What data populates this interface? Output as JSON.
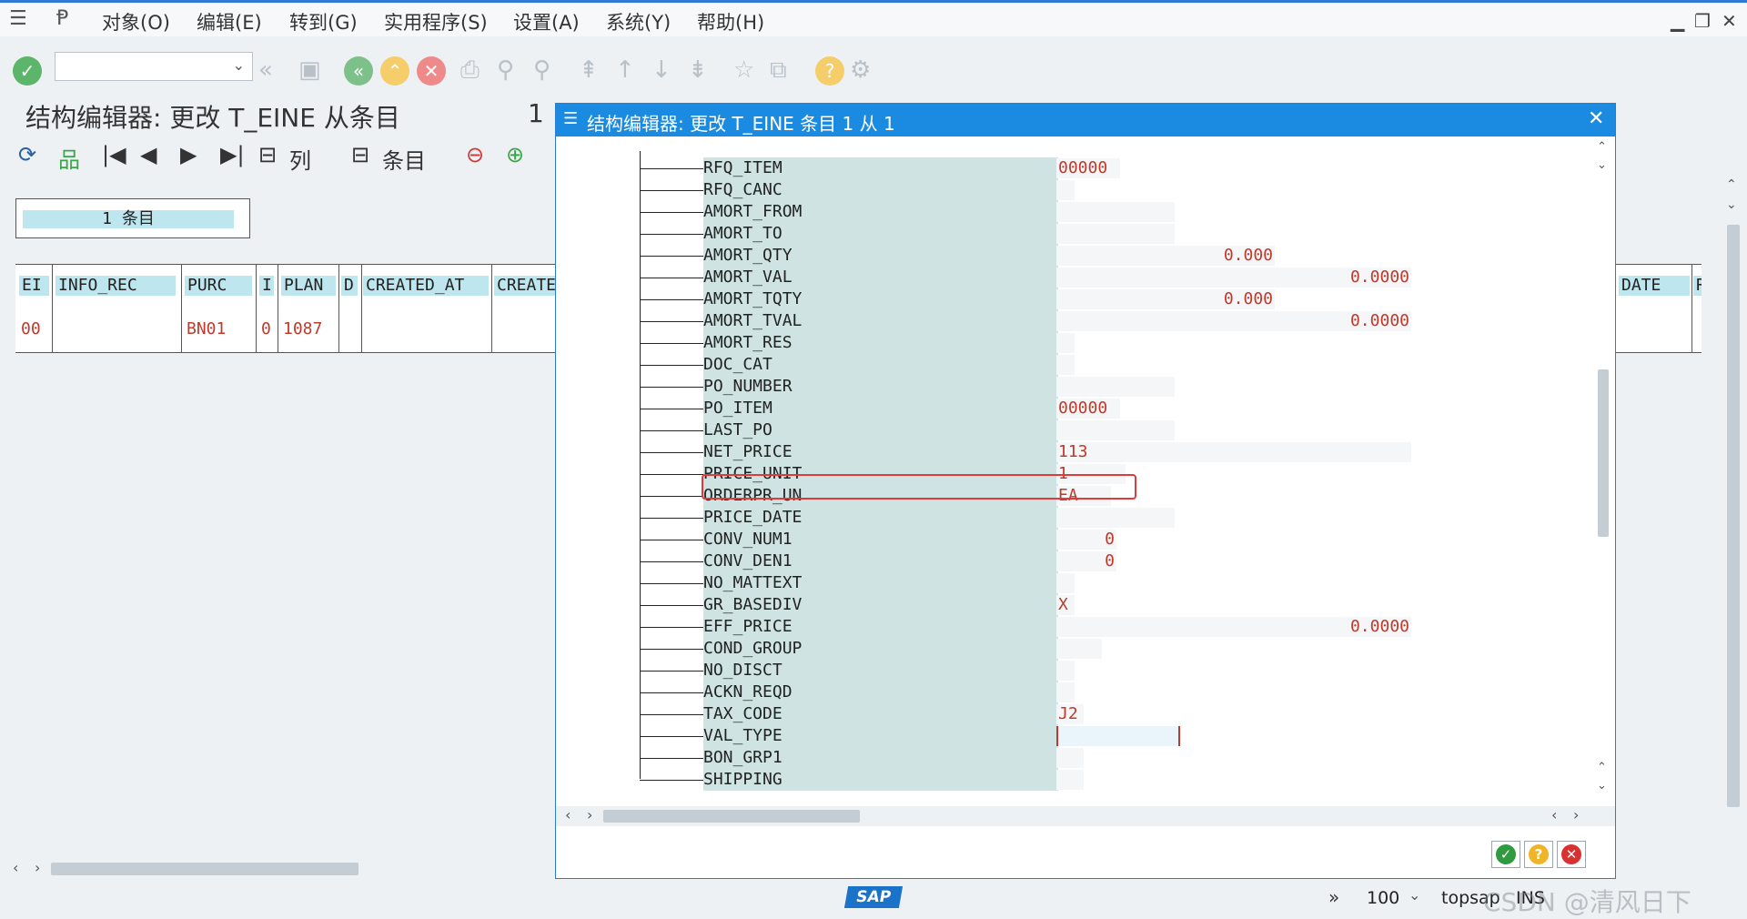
{
  "menu": {
    "items": [
      "对象(O)",
      "编辑(E)",
      "转到(G)",
      "实用程序(S)",
      "设置(A)",
      "系统(Y)",
      "帮助(H)"
    ]
  },
  "toolbar": {
    "icons": [
      "enter-icon",
      "back-icon",
      "save-icon",
      "exit-icon",
      "up-icon",
      "cancel-icon",
      "print-icon",
      "find-icon",
      "find-next-icon",
      "first-page-icon",
      "prev-page-icon",
      "next-page-icon",
      "last-page-icon",
      "new-session-icon",
      "shortcut-icon",
      "help-icon",
      "settings-icon"
    ],
    "colors": {
      "green": "#3aa64a",
      "yellow": "#f0b429",
      "red": "#e04747"
    }
  },
  "page": {
    "title": "结构编辑器: 更改 T_EINE 从条目",
    "entry_num": "1"
  },
  "app_toolbar": {
    "col_label": "列",
    "entry_label": "条目"
  },
  "entries_box": {
    "label": "1 条目"
  },
  "grid": {
    "headers": [
      "EI",
      "INFO_REC",
      "PURC",
      "I",
      "PLAN",
      "D",
      "CREATED_AT",
      "CREATE"
    ],
    "row": [
      "00",
      "",
      "BN01",
      "0",
      "1087",
      "",
      "",
      ""
    ],
    "right_headers": [
      "DATE",
      "R"
    ]
  },
  "dialog": {
    "title": "结构编辑器: 更改 T_EINE 条目 1 从 1",
    "rows": [
      {
        "name": "RFQ_ITEM",
        "value": "00000"
      },
      {
        "name": "RFQ_CANC",
        "value": ""
      },
      {
        "name": "AMORT_FROM",
        "value": ""
      },
      {
        "name": "AMORT_TO",
        "value": ""
      },
      {
        "name": "AMORT_QTY",
        "value": "0.000"
      },
      {
        "name": "AMORT_VAL",
        "value": "0.0000"
      },
      {
        "name": "AMORT_TQTY",
        "value": "0.000"
      },
      {
        "name": "AMORT_TVAL",
        "value": "0.0000"
      },
      {
        "name": "AMORT_RES",
        "value": ""
      },
      {
        "name": "DOC_CAT",
        "value": ""
      },
      {
        "name": "PO_NUMBER",
        "value": ""
      },
      {
        "name": "PO_ITEM",
        "value": "00000"
      },
      {
        "name": "LAST_PO",
        "value": ""
      },
      {
        "name": "NET_PRICE",
        "value": "113"
      },
      {
        "name": "PRICE_UNIT",
        "value": "1"
      },
      {
        "name": "ORDERPR_UN",
        "value": "EA"
      },
      {
        "name": "PRICE_DATE",
        "value": ""
      },
      {
        "name": "CONV_NUM1",
        "value": "0"
      },
      {
        "name": "CONV_DEN1",
        "value": "0"
      },
      {
        "name": "NO_MATTEXT",
        "value": ""
      },
      {
        "name": "GR_BASEDIV",
        "value": "X"
      },
      {
        "name": "EFF_PRICE",
        "value": "0.0000"
      },
      {
        "name": "COND_GROUP",
        "value": ""
      },
      {
        "name": "NO_DISCT",
        "value": ""
      },
      {
        "name": "ACKN_REQD",
        "value": ""
      },
      {
        "name": "TAX_CODE",
        "value": "J2"
      },
      {
        "name": "VAL_TYPE",
        "value": ""
      },
      {
        "name": "BON_GRP1",
        "value": ""
      },
      {
        "name": "SHIPPING",
        "value": ""
      }
    ]
  },
  "status": {
    "zoom": "100",
    "system": "topsap",
    "mode": "INS",
    "logo": "SAP",
    "watermark": "CSDN @清风日下"
  }
}
